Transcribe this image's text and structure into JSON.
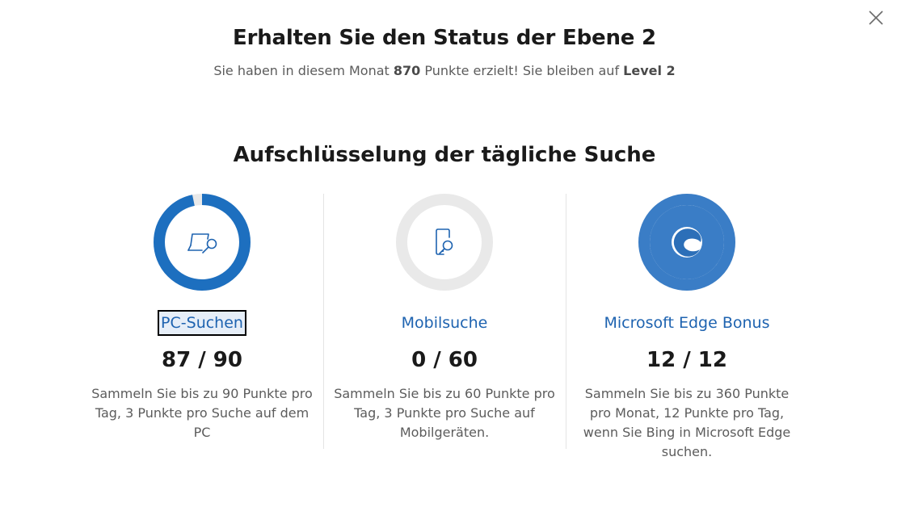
{
  "header": {
    "title": "Erhalten Sie den Status der Ebene 2",
    "subtitle_prefix": "Sie haben in diesem Monat ",
    "points": "870",
    "subtitle_middle": " Punkte erzielt! Sie bleiben auf ",
    "level": "Level 2"
  },
  "section_title": "Aufschlüsselung der tägliche Suche",
  "colors": {
    "accent": "#1e63b0",
    "ring_blue": "#1d6fbf",
    "ring_track": "#e9e9e9"
  },
  "cards": [
    {
      "label": "PC-Suchen",
      "score": "87 / 90",
      "progress": 0.967,
      "icon": "pc-search-icon",
      "description": "Sammeln Sie bis zu 90 Punkte pro Tag, 3 Punkte pro Suche auf dem PC"
    },
    {
      "label": "Mobilsuche",
      "score": "0 / 60",
      "progress": 0,
      "icon": "mobile-search-icon",
      "description": "Sammeln Sie bis zu 60 Punkte pro Tag, 3 Punkte pro Suche auf Mobilgeräten."
    },
    {
      "label": "Microsoft Edge Bonus",
      "score": "12 / 12",
      "progress": 1,
      "icon": "edge-icon",
      "description": "Sammeln Sie bis zu 360 Punkte pro Monat, 12 Punkte pro Tag, wenn Sie Bing in Microsoft Edge suchen."
    }
  ]
}
